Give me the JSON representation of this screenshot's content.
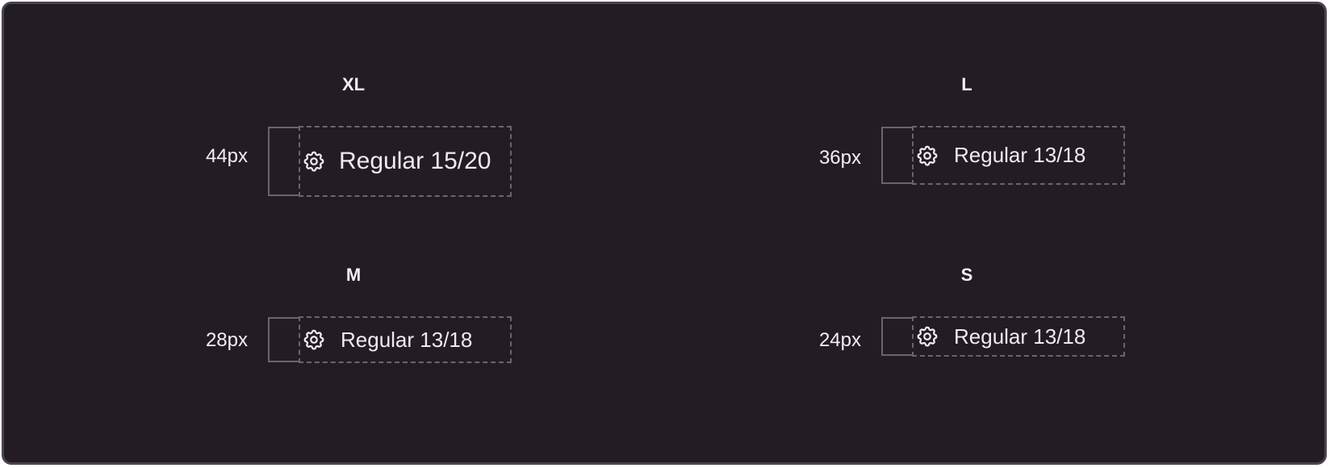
{
  "variants": [
    {
      "title": "XL",
      "height_label": "44px",
      "item_label": "Regular 15/20",
      "icon": "gear-icon"
    },
    {
      "title": "L",
      "height_label": "36px",
      "item_label": "Regular 13/18",
      "icon": "gear-icon"
    },
    {
      "title": "M",
      "height_label": "28px",
      "item_label": "Regular 13/18",
      "icon": "gear-icon"
    },
    {
      "title": "S",
      "height_label": "24px",
      "item_label": "Regular 13/18",
      "icon": "gear-icon"
    }
  ],
  "colors": {
    "background": "#241c25",
    "text": "#f2eef4",
    "outline": "#6b646f"
  }
}
